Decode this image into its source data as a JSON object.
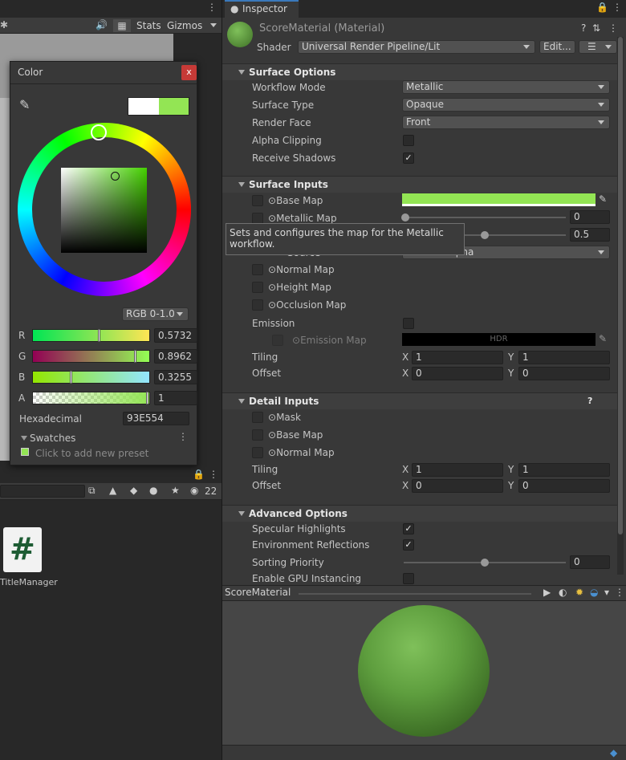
{
  "scene_toolbar": {
    "stats_label": "Stats",
    "gizmos_label": "Gizmos"
  },
  "color_picker": {
    "title": "Color",
    "close": "x",
    "mode": "RGB 0-1.0",
    "channels": [
      {
        "label": "R",
        "value": "0.5732",
        "fraction": 0.5732
      },
      {
        "label": "G",
        "value": "0.8962",
        "fraction": 0.8962
      },
      {
        "label": "B",
        "value": "0.3255",
        "fraction": 0.3255
      },
      {
        "label": "A",
        "value": "1",
        "fraction": 1
      }
    ],
    "hex_label": "Hexadecimal",
    "hex_value": "93E554",
    "swatches_label": "Swatches",
    "swatches_hint": "Click to add new preset",
    "colors": {
      "current": "#93E554",
      "previous": "#ffffff"
    }
  },
  "project": {
    "badge_count": "22",
    "asset_name": "TitleManager",
    "asset_glyph": "#"
  },
  "inspector": {
    "tab_title": "Inspector",
    "material_name": "ScoreMaterial (Material)",
    "shader_label": "Shader",
    "shader_value": "Universal Render Pipeline/Lit",
    "edit_label": "Edit...",
    "surface_options": {
      "title": "Surface Options",
      "workflow_label": "Workflow Mode",
      "workflow_value": "Metallic",
      "surface_type_label": "Surface Type",
      "surface_type_value": "Opaque",
      "render_face_label": "Render Face",
      "render_face_value": "Front",
      "alpha_label": "Alpha Clipping",
      "receive_label": "Receive Shadows"
    },
    "surface_inputs": {
      "title": "Surface Inputs",
      "base_map": "Base Map",
      "metallic_map": "Metallic Map",
      "metallic_value": "0",
      "smoothness_value": "0.5",
      "source_label": "Source",
      "source_value": "Metallic Alpha",
      "normal_map": "Normal Map",
      "height_map": "Height Map",
      "occlusion_map": "Occlusion Map",
      "emission_label": "Emission",
      "emission_map": "Emission Map",
      "hdr_label": "HDR",
      "tiling_label": "Tiling",
      "tiling_x": "1",
      "tiling_y": "1",
      "offset_label": "Offset",
      "offset_x": "0",
      "offset_y": "0"
    },
    "tooltip": "Sets and configures the map for the Metallic workflow.",
    "detail_inputs": {
      "title": "Detail Inputs",
      "mask": "Mask",
      "base_map": "Base Map",
      "normal_map": "Normal Map",
      "tiling_label": "Tiling",
      "tiling_x": "1",
      "tiling_y": "1",
      "offset_label": "Offset",
      "offset_x": "0",
      "offset_y": "0"
    },
    "advanced_options": {
      "title": "Advanced Options",
      "specular_label": "Specular Highlights",
      "env_label": "Environment Reflections",
      "sorting_label": "Sorting Priority",
      "sorting_value": "0",
      "gpu_label": "Enable GPU Instancing"
    },
    "axis_x": "X",
    "axis_y": "Y",
    "preview_title": "ScoreMaterial"
  }
}
